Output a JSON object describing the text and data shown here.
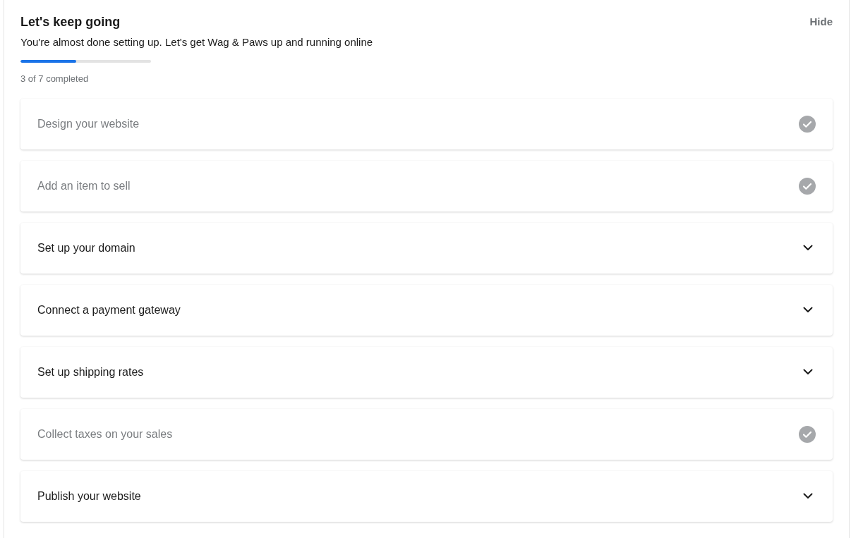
{
  "header": {
    "title": "Let's keep going",
    "subtitle": "You're almost done setting up. Let's get Wag & Paws up and running online",
    "hide_link": "Hide"
  },
  "progress": {
    "level": 0.4286,
    "label": "3 of 7 completed"
  },
  "tasks": [
    {
      "label": "Design your website",
      "completed": true
    },
    {
      "label": "Add an item to sell",
      "completed": true
    },
    {
      "label": "Set up your domain",
      "completed": false
    },
    {
      "label": "Connect a payment gateway",
      "completed": false
    },
    {
      "label": "Set up shipping rates",
      "completed": false
    },
    {
      "label": "Collect taxes on your sales",
      "completed": true
    },
    {
      "label": "Publish your website",
      "completed": false
    }
  ]
}
